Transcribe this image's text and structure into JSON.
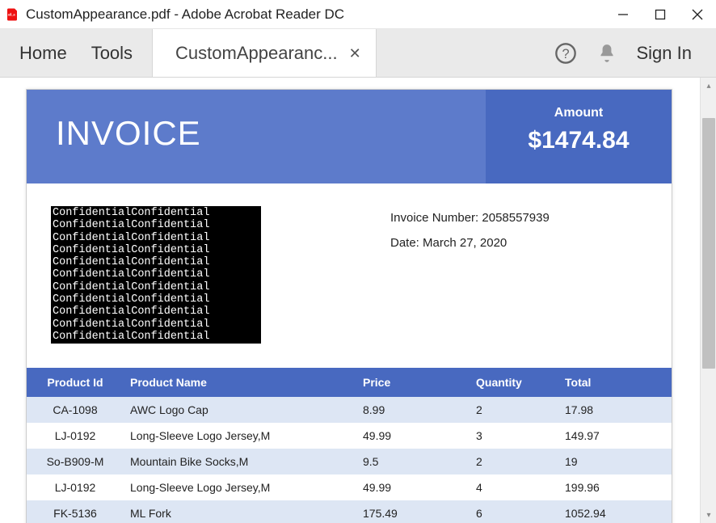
{
  "window": {
    "title": "CustomAppearance.pdf - Adobe Acrobat Reader DC"
  },
  "toolbar": {
    "home": "Home",
    "tools": "Tools",
    "tab_label": "CustomAppearanc...",
    "sign_in": "Sign In"
  },
  "invoice": {
    "title": "INVOICE",
    "amount_label": "Amount",
    "amount_value": "$1474.84",
    "meta": {
      "number_label": "Invoice Number: ",
      "number_value": "2058557939",
      "date_label": "Date: ",
      "date_value": "March 27, 2020"
    },
    "redaction_word": "Confidential",
    "redaction_rows": 11,
    "headers": {
      "id": "Product Id",
      "name": "Product Name",
      "price": "Price",
      "qty": "Quantity",
      "total": "Total"
    },
    "items": [
      {
        "id": "CA-1098",
        "name": "AWC Logo Cap",
        "price": "8.99",
        "qty": "2",
        "total": "17.98"
      },
      {
        "id": "LJ-0192",
        "name": "Long-Sleeve Logo Jersey,M",
        "price": "49.99",
        "qty": "3",
        "total": "149.97"
      },
      {
        "id": "So-B909-M",
        "name": "Mountain Bike Socks,M",
        "price": "9.5",
        "qty": "2",
        "total": "19"
      },
      {
        "id": "LJ-0192",
        "name": "Long-Sleeve Logo Jersey,M",
        "price": "49.99",
        "qty": "4",
        "total": "199.96"
      },
      {
        "id": "FK-5136",
        "name": "ML Fork",
        "price": "175.49",
        "qty": "6",
        "total": "1052.94"
      }
    ]
  }
}
